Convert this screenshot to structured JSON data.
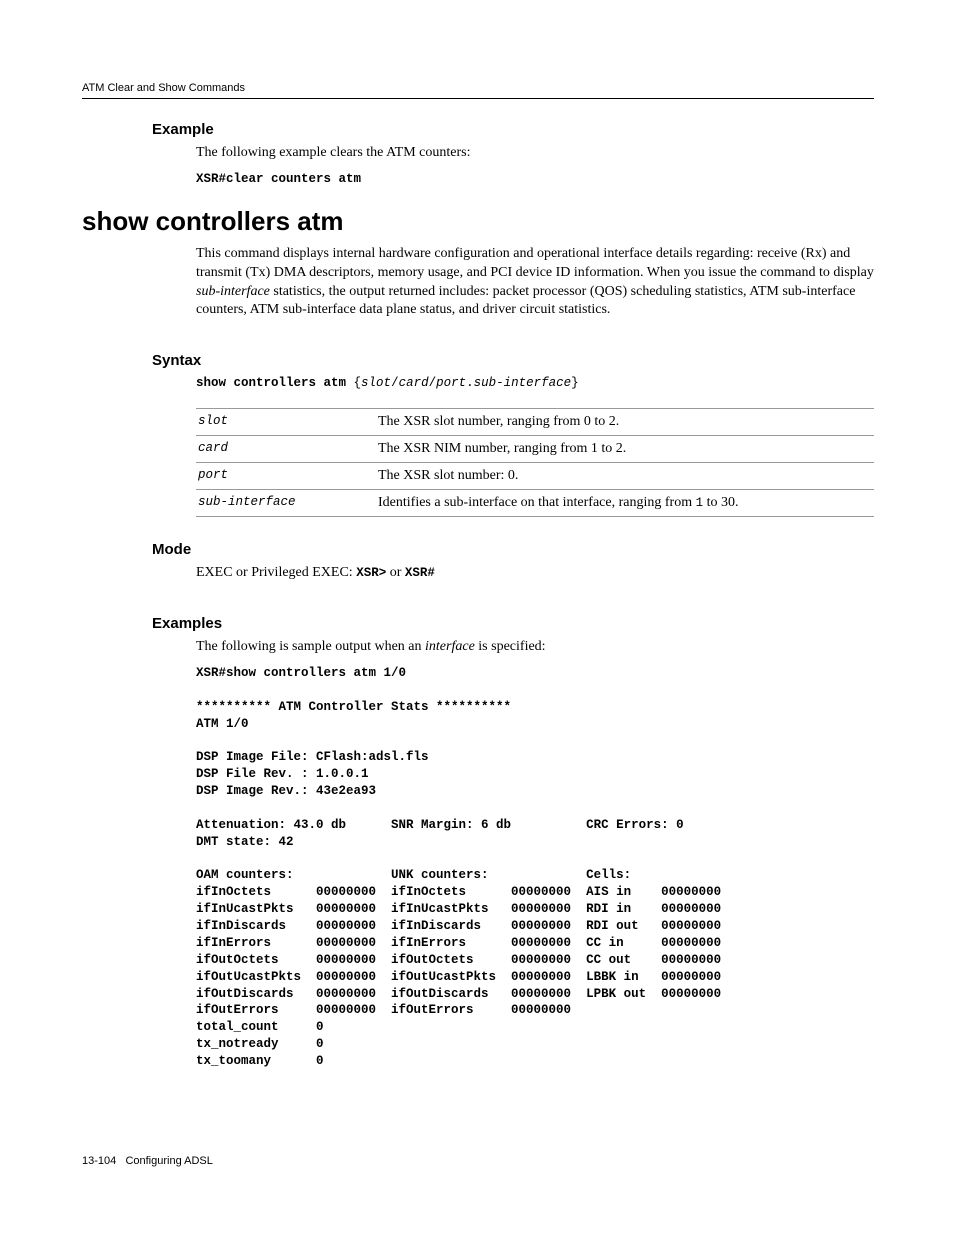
{
  "header": {
    "running": "ATM Clear and Show Commands"
  },
  "example1": {
    "heading": "Example",
    "intro": "The following example clears the ATM counters:",
    "code": "XSR#clear counters atm"
  },
  "command": {
    "title": "show controllers atm",
    "desc_pre": "This command displays internal hardware configuration and operational interface details regarding: receive (Rx) and transmit (Tx) DMA descriptors, memory usage, and PCI device ID information. When you issue the command to display ",
    "desc_em": "sub-interface",
    "desc_post": " statistics, the output returned includes: packet processor (QOS) scheduling statistics, ATM sub-interface counters, ATM sub-interface data plane status, and driver circuit statistics."
  },
  "syntax": {
    "heading": "Syntax",
    "cmd": "show controllers atm",
    "args": [
      "slot",
      "card",
      "port",
      "sub-interface"
    ],
    "params": [
      {
        "name": "slot",
        "desc": "The XSR slot number, ranging from 0 to 2."
      },
      {
        "name": "card",
        "desc": "The XSR NIM number, ranging from 1 to 2."
      },
      {
        "name": "port",
        "desc": "The XSR slot number: 0."
      },
      {
        "name": "sub-interface",
        "desc_pre": "Identifies a sub-interface on that interface, ranging from",
        "desc_code": "1",
        "desc_post": "to 30."
      }
    ]
  },
  "mode": {
    "heading": "Mode",
    "text": "EXEC or Privileged EXEC: ",
    "prompt1": "XSR>",
    "or": " or ",
    "prompt2": "XSR#"
  },
  "examples": {
    "heading": "Examples",
    "intro_pre": "The following is sample output when an ",
    "intro_em": "interface",
    "intro_post": " is specified:",
    "output": "XSR#show controllers atm 1/0\n\n********** ATM Controller Stats **********\nATM 1/0\n\nDSP Image File: CFlash:adsl.fls\nDSP File Rev. : 1.0.0.1\nDSP Image Rev.: 43e2ea93\n\nAttenuation: 43.0 db      SNR Margin: 6 db          CRC Errors: 0\nDMT state: 42\n\nOAM counters:             UNK counters:             Cells:\nifInOctets      00000000  ifInOctets      00000000  AIS in    00000000\nifInUcastPkts   00000000  ifInUcastPkts   00000000  RDI in    00000000\nifInDiscards    00000000  ifInDiscards    00000000  RDI out   00000000\nifInErrors      00000000  ifInErrors      00000000  CC in     00000000\nifOutOctets     00000000  ifOutOctets     00000000  CC out    00000000\nifOutUcastPkts  00000000  ifOutUcastPkts  00000000  LBBK in   00000000\nifOutDiscards   00000000  ifOutDiscards   00000000  LPBK out  00000000\nifOutErrors     00000000  ifOutErrors     00000000\ntotal_count     0\ntx_notready     0\ntx_toomany      0"
  },
  "footer": {
    "page": "13-104",
    "title": "Configuring ADSL"
  }
}
